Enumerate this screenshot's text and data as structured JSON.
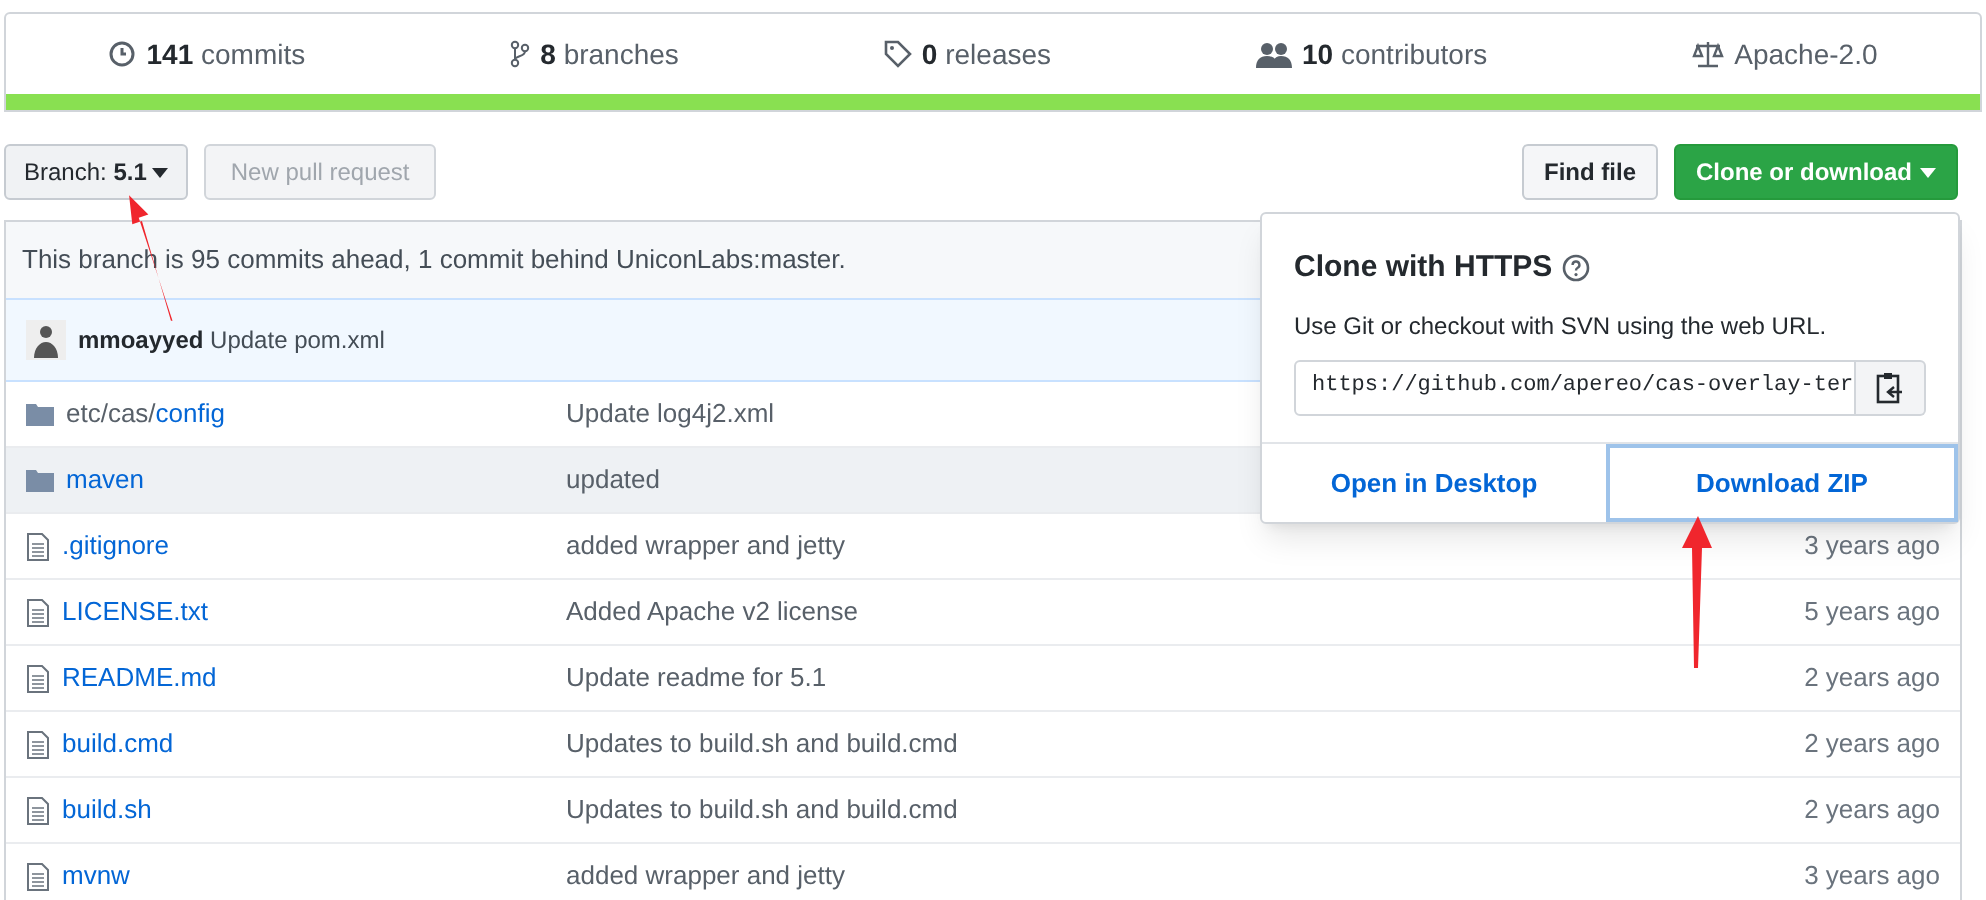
{
  "stats": [
    {
      "kind": "commits",
      "count": "141",
      "label": "commits"
    },
    {
      "kind": "branches",
      "count": "8",
      "label": "branches"
    },
    {
      "kind": "releases",
      "count": "0",
      "label": "releases"
    },
    {
      "kind": "contributors",
      "count": "10",
      "label": "contributors"
    },
    {
      "kind": "license",
      "label": "Apache-2.0"
    }
  ],
  "toolbar": {
    "branch_label": "Branch:",
    "branch": "5.1",
    "new_pull_request": "New pull request",
    "find_file": "Find file",
    "clone": "Clone or download"
  },
  "branch_info": "This branch is 95 commits ahead, 1 commit behind UniconLabs:master.",
  "latest_commit": {
    "author": "mmoayyed",
    "message": "Update pom.xml"
  },
  "files": [
    {
      "kind": "folder",
      "dir": "etc/cas/",
      "name": "config",
      "message": "Update log4j2.xml",
      "highlighted": false
    },
    {
      "kind": "folder",
      "name": "maven",
      "message": "updated",
      "highlighted": true
    },
    {
      "kind": "file",
      "name": ".gitignore",
      "message": "added wrapper and jetty",
      "age": "3 years ago",
      "highlighted": false
    },
    {
      "kind": "file",
      "name": "LICENSE.txt",
      "message": "Added Apache v2 license",
      "age": "5 years ago",
      "highlighted": false
    },
    {
      "kind": "file",
      "name": "README.md",
      "message": "Update readme for 5.1",
      "age": "2 years ago",
      "highlighted": false
    },
    {
      "kind": "file",
      "name": "build.cmd",
      "message": "Updates to build.sh and build.cmd",
      "age": "2 years ago",
      "highlighted": false
    },
    {
      "kind": "file",
      "name": "build.sh",
      "message": "Updates to build.sh and build.cmd",
      "age": "2 years ago",
      "highlighted": false
    },
    {
      "kind": "file",
      "name": "mvnw",
      "message": "added wrapper and jetty",
      "age": "3 years ago",
      "highlighted": false
    }
  ],
  "clone_popup": {
    "title": "Clone with HTTPS",
    "description": "Use Git or checkout with SVN using the web URL.",
    "url": "https://github.com/apereo/cas-overlay-ter",
    "open_desktop": "Open in Desktop",
    "download_zip": "Download ZIP",
    "download_focused": true
  }
}
